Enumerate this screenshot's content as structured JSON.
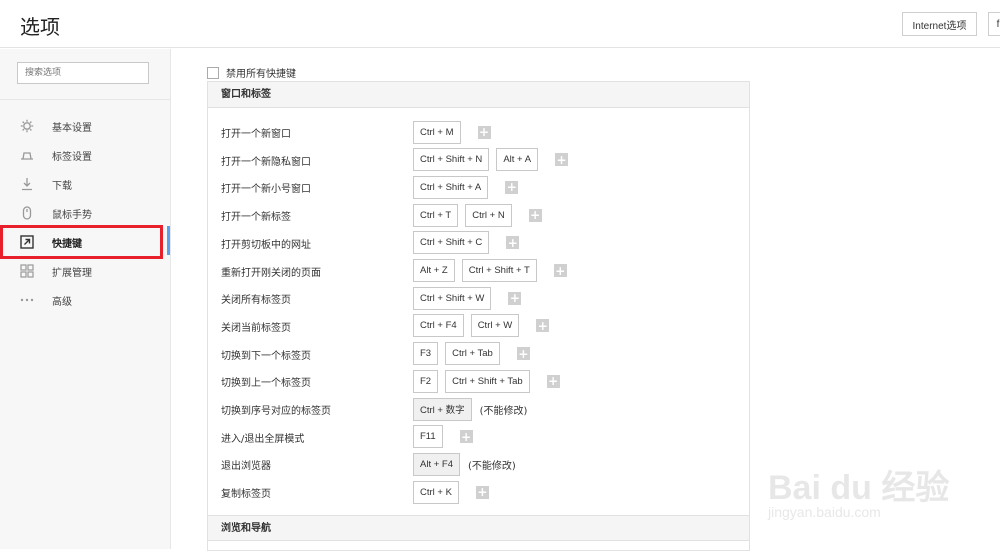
{
  "header": {
    "title": "选项",
    "internet_options_label": "Internet选项",
    "more_label": "f"
  },
  "sidebar": {
    "search_placeholder": "搜索选项",
    "items": [
      {
        "label": "基本设置",
        "icon": "gear-icon"
      },
      {
        "label": "标签设置",
        "icon": "tab-icon"
      },
      {
        "label": "下载",
        "icon": "download-icon"
      },
      {
        "label": "鼠标手势",
        "icon": "mouse-icon"
      },
      {
        "label": "快捷键",
        "icon": "shortcut-icon",
        "active": true
      },
      {
        "label": "扩展管理",
        "icon": "extensions-icon"
      },
      {
        "label": "高级",
        "icon": "more-dots-icon"
      }
    ]
  },
  "main": {
    "disable_all_label": "禁用所有快捷键",
    "disable_all_checked": false,
    "section_window": "窗口和标签",
    "section_browse": "浏览和导航",
    "locked_note": "(不能修改)",
    "add_label": "+",
    "shortcuts": [
      {
        "label": "打开一个新窗口",
        "keys": [
          "Ctrl + M"
        ]
      },
      {
        "label": "打开一个新隐私窗口",
        "keys": [
          "Ctrl + Shift + N",
          "Alt + A"
        ]
      },
      {
        "label": "打开一个新小号窗口",
        "keys": [
          "Ctrl + Shift + A"
        ]
      },
      {
        "label": "打开一个新标签",
        "keys": [
          "Ctrl + T",
          "Ctrl + N"
        ]
      },
      {
        "label": "打开剪切板中的网址",
        "keys": [
          "Ctrl + Shift + C"
        ]
      },
      {
        "label": "重新打开刚关闭的页面",
        "keys": [
          "Alt + Z",
          "Ctrl + Shift + T"
        ]
      },
      {
        "label": "关闭所有标签页",
        "keys": [
          "Ctrl + Shift + W"
        ]
      },
      {
        "label": "关闭当前标签页",
        "keys": [
          "Ctrl + F4",
          "Ctrl + W"
        ]
      },
      {
        "label": "切换到下一个标签页",
        "keys": [
          "F3",
          "Ctrl + Tab"
        ]
      },
      {
        "label": "切换到上一个标签页",
        "keys": [
          "F2",
          "Ctrl + Shift + Tab"
        ]
      },
      {
        "label": "切换到序号对应的标签页",
        "keys": [
          "Ctrl + 数字"
        ],
        "locked": true
      },
      {
        "label": "进入/退出全屏模式",
        "keys": [
          "F11"
        ]
      },
      {
        "label": "退出浏览器",
        "keys": [
          "Alt + F4"
        ],
        "locked": true
      },
      {
        "label": "复制标签页",
        "keys": [
          "Ctrl + K"
        ]
      }
    ]
  },
  "watermark": {
    "text": "Bai du 经验",
    "sub": "jingyan.baidu.com"
  },
  "colors": {
    "active_marker": "#5aa0ec",
    "highlight_box": "#e8202c"
  }
}
